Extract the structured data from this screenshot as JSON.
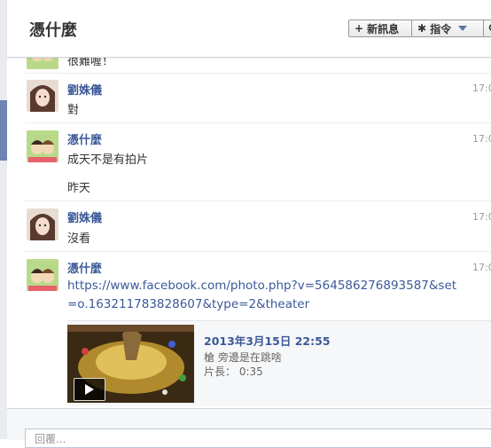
{
  "header": {
    "title": "憑什麼",
    "new_message_label": "新訊息",
    "actions_label": "指令"
  },
  "messages": [
    {
      "text": "很難喔！"
    },
    {
      "sender": "劉姝儀",
      "time": "17:0",
      "lines": [
        "對"
      ]
    },
    {
      "sender": "憑什麼",
      "time": "17:0",
      "lines": [
        "成天不是有拍片",
        "昨天"
      ]
    },
    {
      "sender": "劉姝儀",
      "time": "17:0",
      "lines": [
        "沒看"
      ]
    },
    {
      "sender": "憑什麼",
      "time": "17:0",
      "link": "https://www.facebook.com/photo.php?v=564586276893587&set=o.163211783828607&type=2&theater"
    }
  ],
  "preview": {
    "title": "2013年3月15日 22:55",
    "desc": "槍 旁邊是在跳啥",
    "length": "片長： 0:35"
  },
  "composer": {
    "placeholder": "回覆..."
  },
  "colors": {
    "link": "#3b5998",
    "accent": "#6d84b4",
    "text": "#333333",
    "muted": "#999999"
  },
  "icons": [
    "plus-icon",
    "gear-icon",
    "chevron-down-icon",
    "search-icon",
    "play-icon"
  ]
}
